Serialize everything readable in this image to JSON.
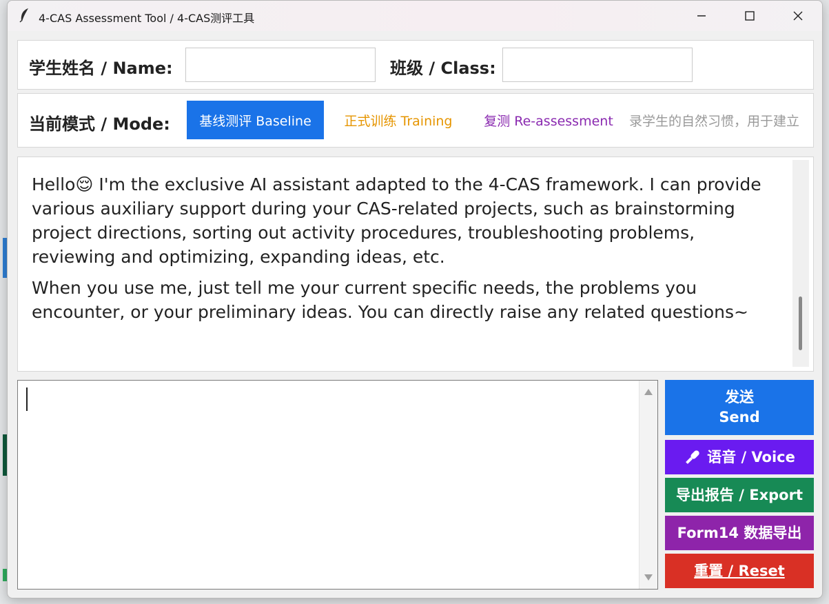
{
  "window": {
    "title": "4-CAS Assessment Tool / 4-CAS测评工具"
  },
  "student": {
    "name_label": "学生姓名 / Name:",
    "name_value": "",
    "class_label": "班级 / Class:",
    "class_value": ""
  },
  "mode": {
    "label": "当前模式 / Mode:",
    "options": [
      {
        "label": "基线测评 Baseline",
        "selected": true,
        "color": "#1a73e8"
      },
      {
        "label": "正式训练 Training",
        "selected": false,
        "color": "#e69500"
      },
      {
        "label": "复测 Re-assessment",
        "selected": false,
        "color": "#8a2ab0"
      }
    ],
    "hint": "录学生的自然习惯，用于建立"
  },
  "chat": {
    "paragraphs": [
      "Hello😌 I'm the exclusive AI assistant adapted to the 4-CAS framework. I can provide various auxiliary support during your CAS-related projects, such as brainstorming project directions, sorting out activity procedures, troubleshooting problems, reviewing and optimizing, expanding ideas, etc.",
      "When you use me, just tell me your current specific needs, the problems you encounter, or your preliminary ideas. You can directly raise any related questions~"
    ]
  },
  "input": {
    "value": ""
  },
  "actions": {
    "send_line1": "发送",
    "send_line2": "Send",
    "voice": "语音 / Voice",
    "export": "导出报告 / Export",
    "form14": "Form14 数据导出",
    "reset": "重置 / Reset"
  },
  "colors": {
    "send": "#1a73e8",
    "voice": "#6a1bf0",
    "export": "#178a55",
    "form14": "#8e24aa",
    "reset": "#d93025"
  },
  "icons": [
    "feather-icon",
    "minimize-icon",
    "maximize-icon",
    "close-icon",
    "microphone-icon"
  ]
}
